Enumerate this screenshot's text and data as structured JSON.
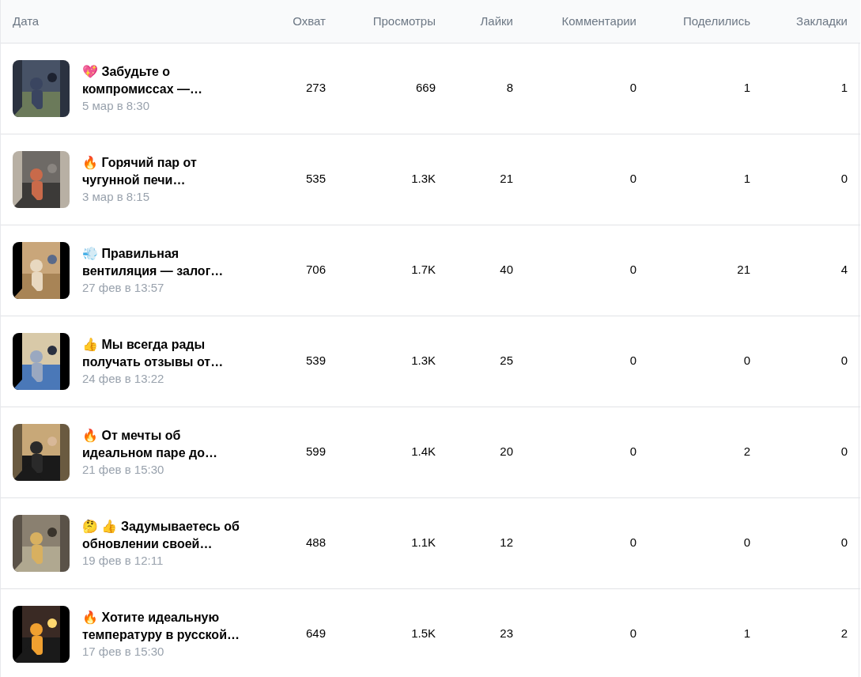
{
  "table": {
    "columns": [
      "Дата",
      "Охват",
      "Просмотры",
      "Лайки",
      "Комментарии",
      "Поделились",
      "Закладки"
    ],
    "rows": [
      {
        "thumbnail": {
          "kind": "picture"
        },
        "title": "💖 Забудьте о компромиссах —…",
        "date": "5 мар в 8:30",
        "values": [
          "273",
          "669",
          "8",
          "0",
          "1",
          "1"
        ]
      },
      {
        "thumbnail": {
          "kind": "picture"
        },
        "title": "🔥 Горячий пар от чугунной печи…",
        "date": "3 мар в 8:15",
        "values": [
          "535",
          "1.3K",
          "21",
          "0",
          "1",
          "0"
        ]
      },
      {
        "thumbnail": {
          "kind": "picture"
        },
        "title": "💨 Правильная вентиляция — залог…",
        "date": "27 фев в 13:57",
        "values": [
          "706",
          "1.7K",
          "40",
          "0",
          "21",
          "4"
        ]
      },
      {
        "thumbnail": {
          "kind": "picture"
        },
        "title": "👍 Мы всегда рады получать отзывы от…",
        "date": "24 фев в 13:22",
        "values": [
          "539",
          "1.3K",
          "25",
          "0",
          "0",
          "0"
        ]
      },
      {
        "thumbnail": {
          "kind": "picture"
        },
        "title": "🔥 От мечты об идеальном паре до…",
        "date": "21 фев в 15:30",
        "values": [
          "599",
          "1.4K",
          "20",
          "0",
          "2",
          "0"
        ]
      },
      {
        "thumbnail": {
          "kind": "picture"
        },
        "title": "🤔 👍 Задумываетесь об обновлении своей…",
        "date": "19 фев в 12:11",
        "values": [
          "488",
          "1.1K",
          "12",
          "0",
          "0",
          "0"
        ]
      },
      {
        "thumbnail": {
          "kind": "picture"
        },
        "title": "🔥 Хотите идеальную температуру в русской…",
        "date": "17 фев в 15:30",
        "values": [
          "649",
          "1.5K",
          "23",
          "0",
          "1",
          "2"
        ]
      }
    ]
  }
}
